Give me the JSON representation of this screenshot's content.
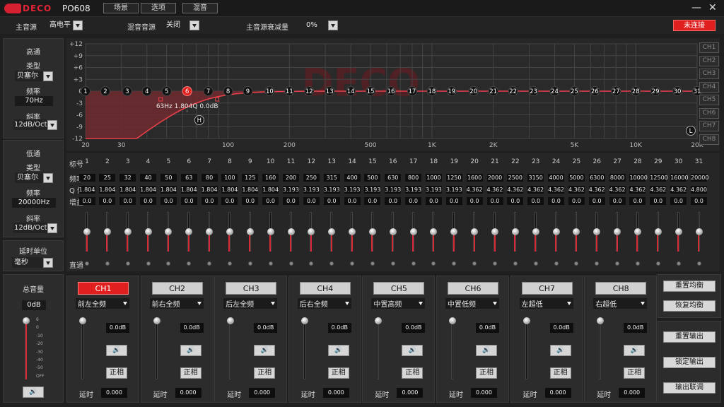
{
  "app": {
    "brand": "DECO",
    "model": "PO608",
    "menu": [
      "场景",
      "选项",
      "混音"
    ],
    "minimize": "—",
    "close": "✕"
  },
  "source_bar": {
    "main_source_label": "主音源",
    "main_source_value": "高电平",
    "mix_source_label": "混音音源",
    "mix_source_value": "关闭",
    "attenuation_label": "主音源衰减量",
    "attenuation_value": "0%",
    "connection_status": "未连接"
  },
  "highpass": {
    "title": "高通",
    "type_label": "类型",
    "type_value": "贝塞尔",
    "freq_label": "频率",
    "freq_value": "70Hz",
    "slope_label": "斜率",
    "slope_value": "12dB/Oct"
  },
  "lowpass": {
    "title": "低通",
    "type_label": "类型",
    "type_value": "贝塞尔",
    "freq_label": "频率",
    "freq_value": "20000Hz",
    "slope_label": "斜率",
    "slope_value": "12dB/Oct"
  },
  "delay_unit": {
    "label": "延时单位",
    "value": "毫秒"
  },
  "master": {
    "title": "总音量",
    "value": "0dB",
    "scale": [
      "6",
      "0",
      "-10",
      "-20",
      "-30",
      "-40",
      "-50",
      "OFF"
    ],
    "level_fraction": 1.0,
    "speaker_icon": "speaker-icon"
  },
  "graph": {
    "y_ticks": [
      "+12",
      "+9",
      "+6",
      "+3",
      "0",
      "-3",
      "-6",
      "-9",
      "-12"
    ],
    "x_ticks": [
      "20",
      "30",
      "100",
      "200",
      "500",
      "1K",
      "2K",
      "5K",
      "10K",
      "20K"
    ],
    "channels": [
      "CH1",
      "CH2",
      "CH3",
      "CH4",
      "CH5",
      "CH6",
      "CH7",
      "CH8"
    ],
    "selected_band_info": [
      "63Hz",
      "1.804Q",
      "0.0dB"
    ],
    "selected_band": 6,
    "hp_marker": "H",
    "lp_marker": "L"
  },
  "eq": {
    "row_labels": {
      "index": "标号",
      "freq": "频率",
      "q": "Q 值",
      "gain": "增益",
      "bypass": "直通"
    },
    "bands": [
      "1",
      "2",
      "3",
      "4",
      "5",
      "6",
      "7",
      "8",
      "9",
      "10",
      "11",
      "12",
      "13",
      "14",
      "15",
      "16",
      "17",
      "18",
      "19",
      "20",
      "21",
      "22",
      "23",
      "24",
      "25",
      "26",
      "27",
      "28",
      "29",
      "30",
      "31"
    ],
    "freqs": [
      "20",
      "25",
      "32",
      "40",
      "50",
      "63",
      "80",
      "100",
      "125",
      "160",
      "200",
      "250",
      "315",
      "400",
      "500",
      "630",
      "800",
      "1000",
      "1250",
      "1600",
      "2000",
      "2500",
      "3150",
      "4000",
      "5000",
      "6300",
      "8000",
      "10000",
      "12500",
      "16000",
      "20000"
    ],
    "q": [
      "1.804",
      "1.804",
      "1.804",
      "1.804",
      "1.804",
      "1.804",
      "1.804",
      "1.804",
      "1.804",
      "1.804",
      "3.193",
      "3.193",
      "3.193",
      "3.193",
      "3.193",
      "3.193",
      "3.193",
      "3.193",
      "3.193",
      "4.362",
      "4.362",
      "4.362",
      "4.362",
      "4.362",
      "4.362",
      "4.362",
      "4.362",
      "4.362",
      "4.362",
      "4.362",
      "4.800"
    ],
    "gains": [
      "0.0",
      "0.0",
      "0.0",
      "0.0",
      "0.0",
      "0.0",
      "0.0",
      "0.0",
      "0.0",
      "0.0",
      "0.0",
      "0.0",
      "0.0",
      "0.0",
      "0.0",
      "0.0",
      "0.0",
      "0.0",
      "0.0",
      "0.0",
      "0.0",
      "0.0",
      "0.0",
      "0.0",
      "0.0",
      "0.0",
      "0.0",
      "0.0",
      "0.0",
      "0.0",
      "0.0"
    ]
  },
  "channels": [
    {
      "name": "CH1",
      "active": true,
      "position": "前左全频",
      "level": "0.0dB",
      "speaker": "🔊",
      "phase": "正相",
      "delay_label": "延时",
      "delay": "0.000"
    },
    {
      "name": "CH2",
      "active": false,
      "position": "前右全频",
      "level": "0.0dB",
      "speaker": "🔊",
      "phase": "正相",
      "delay_label": "延时",
      "delay": "0.000"
    },
    {
      "name": "CH3",
      "active": false,
      "position": "后左全频",
      "level": "0.0dB",
      "speaker": "🔊",
      "phase": "正相",
      "delay_label": "延时",
      "delay": "0.000"
    },
    {
      "name": "CH4",
      "active": false,
      "position": "后右全频",
      "level": "0.0dB",
      "speaker": "🔊",
      "phase": "正相",
      "delay_label": "延时",
      "delay": "0.000"
    },
    {
      "name": "CH5",
      "active": false,
      "position": "中置高频",
      "level": "0.0dB",
      "speaker": "🔊",
      "phase": "正相",
      "delay_label": "延时",
      "delay": "0.000"
    },
    {
      "name": "CH6",
      "active": false,
      "position": "中置低频",
      "level": "0.0dB",
      "speaker": "🔊",
      "phase": "正相",
      "delay_label": "延时",
      "delay": "0.000"
    },
    {
      "name": "CH7",
      "active": false,
      "position": "左超低",
      "level": "0.0dB",
      "speaker": "🔊",
      "phase": "正相",
      "delay_label": "延时",
      "delay": "0.000"
    },
    {
      "name": "CH8",
      "active": false,
      "position": "右超低",
      "level": "0.0dB",
      "speaker": "🔊",
      "phase": "正相",
      "delay_label": "延时",
      "delay": "0.000"
    }
  ],
  "side_buttons": {
    "reset_eq": "重置均衡",
    "restore_eq": "恢复均衡",
    "reset_output": "重置输出",
    "lock_output": "锁定输出",
    "output_link": "输出联调"
  },
  "colors": {
    "accent": "#e0201e",
    "curve": "#e8404a"
  }
}
